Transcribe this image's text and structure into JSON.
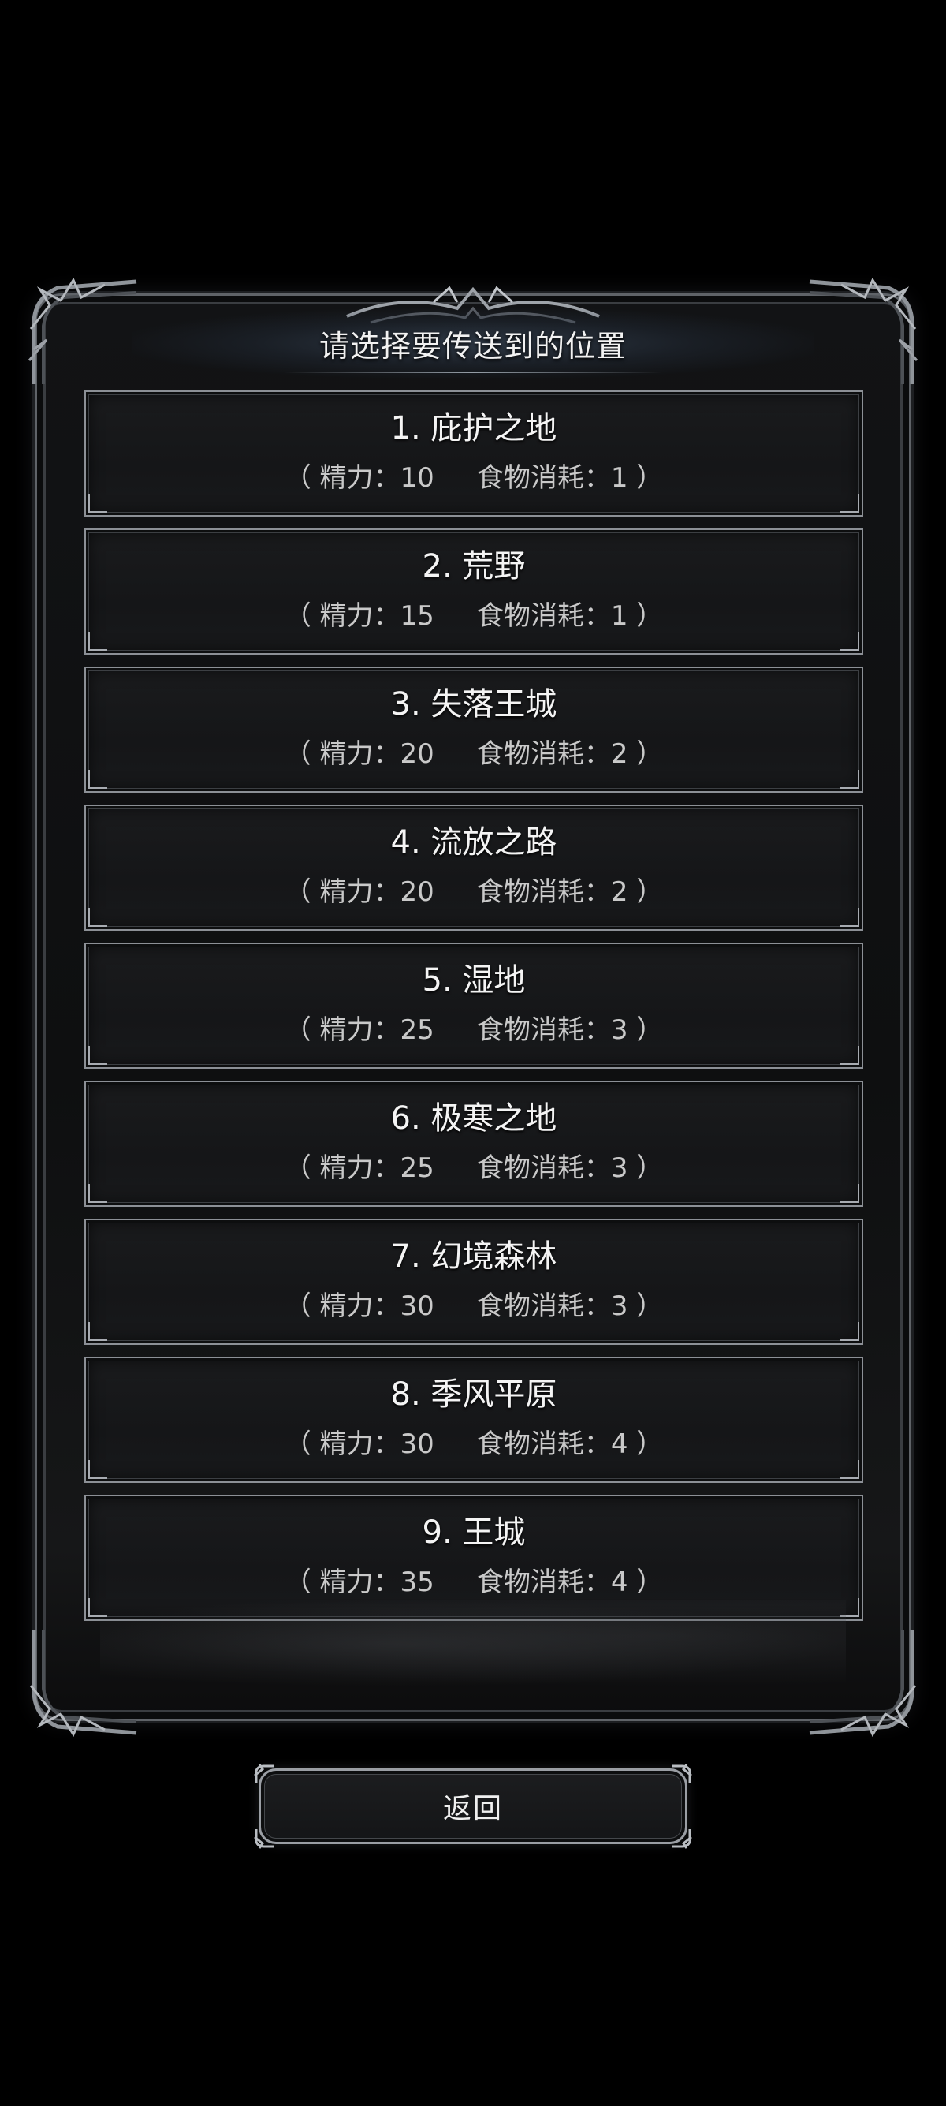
{
  "dialog": {
    "title": "请选择要传送到的位置"
  },
  "locations": [
    {
      "name": "1. 庇护之地",
      "cost": "（ 精力：10     食物消耗：1 ）"
    },
    {
      "name": "2. 荒野",
      "cost": "（ 精力：15     食物消耗：1 ）"
    },
    {
      "name": "3. 失落王城",
      "cost": "（ 精力：20     食物消耗：2 ）"
    },
    {
      "name": "4. 流放之路",
      "cost": "（ 精力：20     食物消耗：2 ）"
    },
    {
      "name": "5. 湿地",
      "cost": "（ 精力：25     食物消耗：3 ）"
    },
    {
      "name": "6. 极寒之地",
      "cost": "（ 精力：25     食物消耗：3 ）"
    },
    {
      "name": "7. 幻境森林",
      "cost": "（ 精力：30     食物消耗：3 ）"
    },
    {
      "name": "8. 季风平原",
      "cost": "（ 精力：30     食物消耗：4 ）"
    },
    {
      "name": "9. 王城",
      "cost": "（ 精力：35     食物消耗：4 ）"
    }
  ],
  "footer": {
    "return_label": "返回"
  }
}
